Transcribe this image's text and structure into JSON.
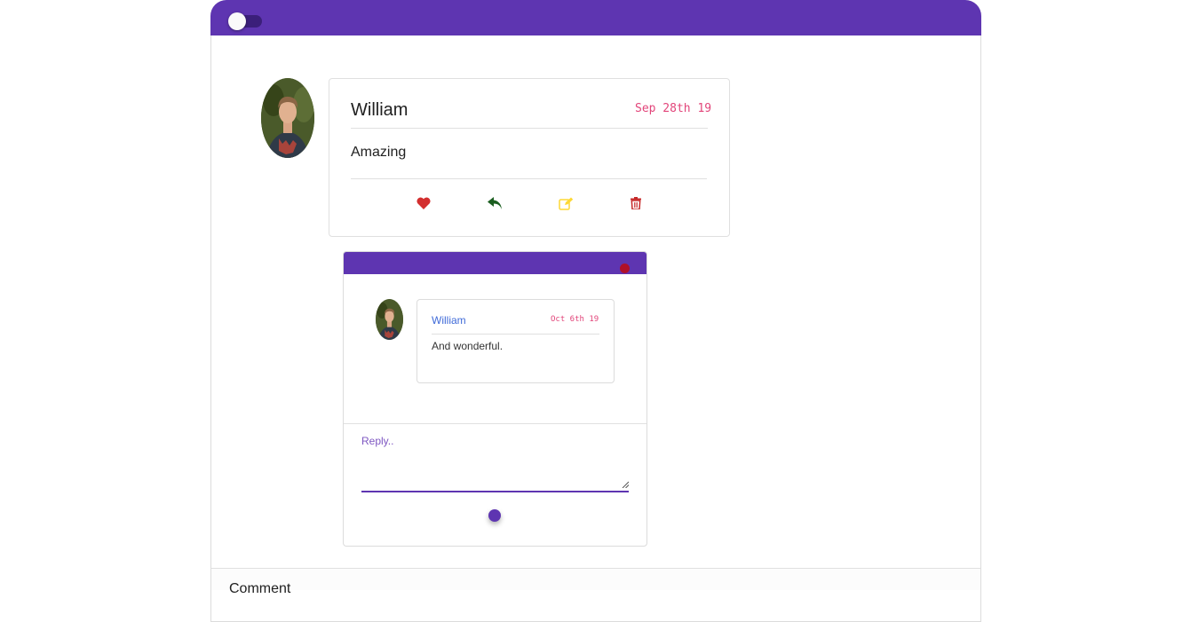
{
  "comment": {
    "author": "William",
    "date": "Sep 28th 19",
    "text": "Amazing",
    "actions": [
      {
        "name": "like",
        "icon": "heart-icon",
        "color": "#d32f2f"
      },
      {
        "name": "reply",
        "icon": "reply-icon",
        "color": "#1b5e20"
      },
      {
        "name": "edit",
        "icon": "edit-icon",
        "color": "#fdd835"
      },
      {
        "name": "delete",
        "icon": "trash-icon",
        "color": "#c62828"
      }
    ]
  },
  "replies": [
    {
      "author": "William",
      "date": "Oct 6th 19",
      "text": "And wonderful."
    }
  ],
  "reply_form": {
    "label": "Reply..",
    "value": ""
  },
  "new_comment": {
    "label": "Comment"
  },
  "theme": {
    "accent": "#5e35b1",
    "date_color": "#e2457a",
    "reply_author_color": "#3f6ad8"
  }
}
